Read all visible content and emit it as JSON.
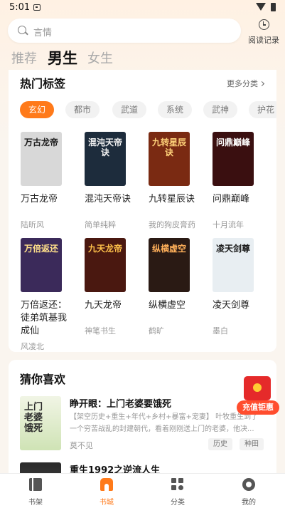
{
  "status_bar": {
    "time": "5:01"
  },
  "header": {
    "search_placeholder": "言情",
    "history_label": "阅读记录"
  },
  "channel_tabs": [
    {
      "label": "推荐",
      "active": false
    },
    {
      "label": "男生",
      "active": true
    },
    {
      "label": "女生",
      "active": false
    }
  ],
  "hot_tags": {
    "title": "热门标签",
    "more_label": "更多分类",
    "tags": [
      "玄幻",
      "都市",
      "武道",
      "系统",
      "武神",
      "护花"
    ],
    "active_tag": "玄幻",
    "books": [
      {
        "title": "万古龙帝",
        "author": "陆昕风",
        "cover_text": "万古龙帝",
        "cover_bg": "#d8d8d8",
        "cover_fg": "#1a1a1a"
      },
      {
        "title": "混沌天帝诀",
        "author": "简单纯粹",
        "cover_text": "混沌天帝诀",
        "cover_bg": "#1d2c3c",
        "cover_fg": "#f2f2f2"
      },
      {
        "title": "九转星辰诀",
        "author": "我的狗皮膏药",
        "cover_text": "九转星辰诀",
        "cover_bg": "#7a2a12",
        "cover_fg": "#ffd27a"
      },
      {
        "title": "问鼎巅峰",
        "author": "十月流年",
        "cover_text": "问鼎巅峰",
        "cover_bg": "#3a0f10",
        "cover_fg": "#ffffff"
      },
      {
        "title": "万倍返还：徒弟筑基我成仙",
        "author": "风凌北",
        "cover_text": "万倍返还",
        "cover_bg": "#3b2a5a",
        "cover_fg": "#ffe08a"
      },
      {
        "title": "九天龙帝",
        "author": "神笔书生",
        "cover_text": "九天龙帝",
        "cover_bg": "#4a1810",
        "cover_fg": "#ffc24a"
      },
      {
        "title": "纵横虚空",
        "author": "鹤旷",
        "cover_text": "纵横虚空",
        "cover_bg": "#2a1a14",
        "cover_fg": "#ffb05a"
      },
      {
        "title": "凌天剑尊",
        "author": "墨白",
        "cover_text": "凌天剑尊",
        "cover_bg": "#e8eef2",
        "cover_fg": "#1a1a1a"
      }
    ]
  },
  "guess": {
    "title": "猜你喜欢",
    "items": [
      {
        "title": "睁开眼：上门老婆要饿死",
        "description": "【架空历史+重生+年代+乡村+暴富+宠妻】 叶牧重生到了一个穷苦战乱的封建朝代，看着刚刚送上门的老婆，他决...",
        "author": "莫不见",
        "tags": [
          "历史",
          "种田"
        ],
        "cover_text": "上门老婆饿死"
      },
      {
        "title": "重生1992之逆流人生"
      }
    ]
  },
  "promo": {
    "label": "充值钜惠"
  },
  "bottom_nav": [
    {
      "label": "书架",
      "icon": "bookshelf-icon",
      "active": false
    },
    {
      "label": "书城",
      "icon": "bookstore-icon",
      "active": true
    },
    {
      "label": "分类",
      "icon": "category-icon",
      "active": false
    },
    {
      "label": "我的",
      "icon": "profile-icon",
      "active": false
    }
  ],
  "colors": {
    "accent": "#ff7a1a",
    "background": "#faf5ef",
    "card": "#ffffff"
  }
}
